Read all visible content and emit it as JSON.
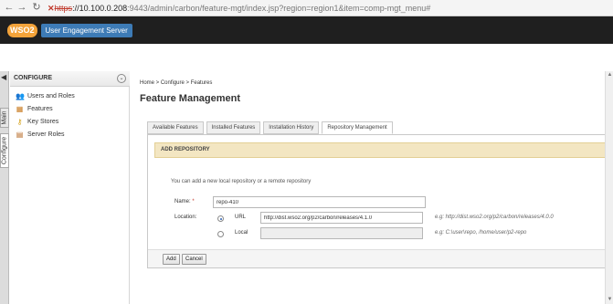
{
  "browser": {
    "back_icon": "back-arrow-icon",
    "forward_icon": "forward-arrow-icon",
    "reload_icon": "reload-icon",
    "https_text": "https",
    "url_host": "://10.100.0.208",
    "url_path": ":9443/admin/carbon/feature-mgt/index.jsp?region=region1&item=comp-mgt_menu#"
  },
  "header": {
    "logo_text": "WSO2",
    "product_name": "User Engagement Server"
  },
  "left_tabs": {
    "main_label": "Main",
    "configure_label": "Configure"
  },
  "sidebar": {
    "title": "CONFIGURE",
    "items": [
      {
        "label": "Users and Roles",
        "icon": "users-icon"
      },
      {
        "label": "Features",
        "icon": "features-icon"
      },
      {
        "label": "Key Stores",
        "icon": "key-icon"
      },
      {
        "label": "Server Roles",
        "icon": "server-roles-icon"
      }
    ]
  },
  "breadcrumb": "Home > Configure > Features",
  "page_title": "Feature Management",
  "tabs": [
    "Available Features",
    "Installed Features",
    "Installation History",
    "Repository Management"
  ],
  "panel": {
    "title": "ADD REPOSITORY",
    "hint": "You can add a new local repository or a remote repository",
    "name_label": "Name:",
    "name_required_mark": "*",
    "name_value": "repo-410",
    "location_label": "Location:",
    "url_label": "URL",
    "url_value": "http://dist.wso2.org/p2/carbon/releases/4.1.0",
    "url_example": "e.g: http://dist.wso2.org/p2/carbon/releases/4.0.0",
    "local_label": "Local",
    "local_value": "",
    "local_example": "e.g: C:\\user\\repo, /home/user/p2-repo",
    "add_button": "Add",
    "cancel_button": "Cancel"
  },
  "colors": {
    "header_bg": "#1f1f1f",
    "panel_head_bg": "#f3e6c2",
    "logo_orange": "#f3a33a",
    "logo_blue": "#3d7bb6"
  }
}
